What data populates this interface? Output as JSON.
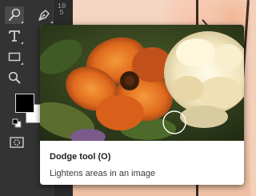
{
  "toolbar": {
    "tools": [
      {
        "name": "Dodge tool",
        "icon": "dodge-icon",
        "selected": true
      },
      {
        "name": "Pen tool",
        "icon": "pen-icon",
        "selected": false
      },
      {
        "name": "Type tool",
        "icon": "type-icon",
        "selected": false
      },
      {
        "name": "Rectangle tool",
        "icon": "rectangle-icon",
        "selected": false
      },
      {
        "name": "Zoom tool",
        "icon": "zoom-icon",
        "selected": false
      }
    ],
    "foreground_color": "#000000",
    "background_color": "#ffffff"
  },
  "ruler": {
    "value": "105"
  },
  "tooltip": {
    "title": "Dodge tool (O)",
    "description": "Lightens areas in an image"
  },
  "colors": {
    "panel": "#333333",
    "tool_selected": "#4a4a4a",
    "icon": "#c9c9c9",
    "tooltip_bg": "#ffffff"
  }
}
